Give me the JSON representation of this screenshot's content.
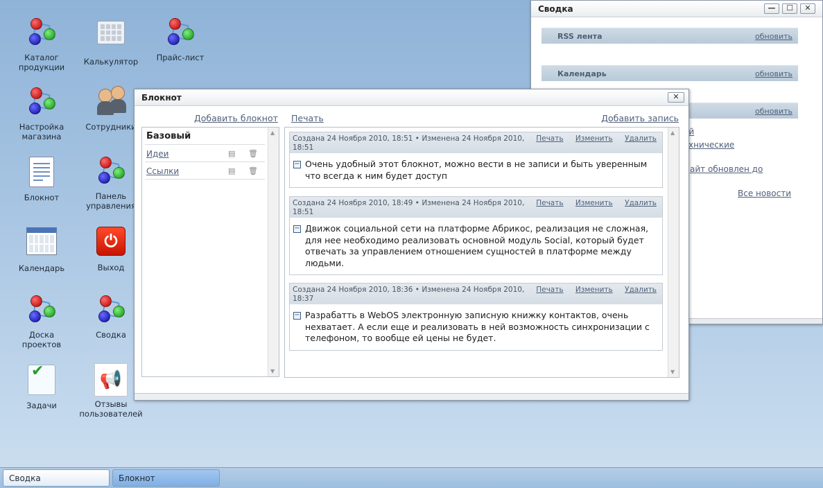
{
  "desktop": {
    "icons": [
      {
        "label": "Каталог\nпродукции",
        "icon": "hex-molecule-icon"
      },
      {
        "label": "Калькулятор",
        "icon": "calculator-icon"
      },
      {
        "label": "Прайс-лист",
        "icon": "hex-molecule-icon"
      },
      {
        "label": "Настройка\nмагазина",
        "icon": "hex-molecule-icon"
      },
      {
        "label": "Сотрудники",
        "icon": "people-icon"
      },
      {
        "label": "Блокнот",
        "icon": "notepad-icon"
      },
      {
        "label": "Панель\nуправления",
        "icon": "hex-molecule-icon"
      },
      {
        "label": "Календарь",
        "icon": "calendar-icon"
      },
      {
        "label": "Выход",
        "icon": "power-icon"
      },
      {
        "label": "Доска\nпроектов",
        "icon": "hex-molecule-icon"
      },
      {
        "label": "Сводка",
        "icon": "hex-molecule-icon"
      },
      {
        "label": "Задачи",
        "icon": "tasks-icon"
      },
      {
        "label": "Отзывы\nпользователей",
        "icon": "megaphone-icon"
      }
    ]
  },
  "svodka": {
    "title": "Сводка",
    "sections": [
      {
        "title": "RSS лента",
        "update": "обновить"
      },
      {
        "title": "Календарь",
        "update": "обновить"
      },
      {
        "title": "",
        "update": "обновить"
      }
    ],
    "news_fragments": [
      "ей",
      "хнические",
      "айт обновлен до"
    ],
    "all_news": "Все новости"
  },
  "bloknot": {
    "title": "Блокнот",
    "add_notebook": "Добавить блокнот",
    "print": "Печать",
    "add_entry": "Добавить запись",
    "notebooks": {
      "current": "Базовый",
      "items": [
        {
          "label": "Идеи"
        },
        {
          "label": "Ссылки"
        }
      ]
    },
    "entries": [
      {
        "meta": "Создана 24 Ноября 2010, 18:51 • Изменена 24 Ноября 2010, 18:51",
        "print": "Печать",
        "edit": "Изменить",
        "delete": "Удалить",
        "text": "Очень удобный этот блокнот, можно вести в не записи и быть уверенным что всегда к ним будет доступ"
      },
      {
        "meta": "Создана 24 Ноября 2010, 18:49 • Изменена 24 Ноября 2010, 18:51",
        "print": "Печать",
        "edit": "Изменить",
        "delete": "Удалить",
        "text": "Движок социальной сети на платформе Абрикос, реализация не сложная, для нее необходимо реализовать основной модуль Social, который будет отвечать за управлением отношением сущностей в платформе между людьми."
      },
      {
        "meta": "Создана 24 Ноября 2010, 18:36 • Изменена 24 Ноября 2010, 18:37",
        "print": "Печать",
        "edit": "Изменить",
        "delete": "Удалить",
        "text": "Разрабатть в WebOS электронную записную книжку контактов, очень нехватает. А если еще и реализовать в ней возможность синхронизации с телефоном, то вообще ей цены не будет."
      }
    ]
  },
  "taskbar": {
    "tasks": [
      {
        "label": "Сводка",
        "active": false
      },
      {
        "label": "Блокнот",
        "active": true
      }
    ]
  },
  "colors": {
    "desktop_top": "#8fb3d8",
    "link": "#50607a",
    "section_header": "#b9c9d8",
    "task_active": "#7fb0e4"
  }
}
